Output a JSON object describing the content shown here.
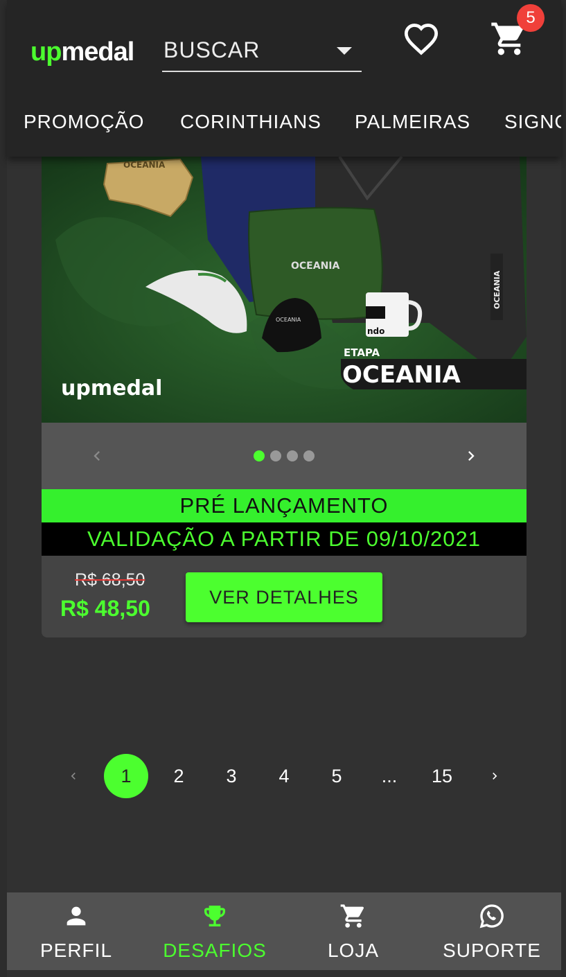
{
  "header": {
    "logo_up": "up",
    "logo_rest": "medal",
    "search_label": "BUSCAR",
    "cart_count": "5",
    "nav": [
      "PROMOÇÃO",
      "CORINTHIANS",
      "PALMEIRAS",
      "SIGNO"
    ]
  },
  "product": {
    "banner": {
      "badge_text": "OCEANIA",
      "etapa": "ETAPA",
      "title": "OCEANIA",
      "brand": "upmedal",
      "cap_text": "OCEANIA",
      "pillow_text": "OCEANIA",
      "mug_text": "ndo",
      "jacket_text": "OCEANIA"
    },
    "carousel": {
      "slides": 4,
      "active": 1
    },
    "ribbon_title": "PRÉ LANÇAMENTO",
    "ribbon_subtitle": "VALIDAÇÃO A PARTIR DE 09/10/2021",
    "old_price": "R$ 68,50",
    "new_price": "R$ 48,50",
    "details_button": "VER DETALHES"
  },
  "pagination": {
    "pages": [
      "1",
      "2",
      "3",
      "4",
      "5",
      "...",
      "15"
    ],
    "active": "1"
  },
  "bottom_nav": [
    {
      "label": "PERFIL",
      "icon": "person-icon",
      "active": false
    },
    {
      "label": "DESAFIOS",
      "icon": "trophy-icon",
      "active": true
    },
    {
      "label": "LOJA",
      "icon": "cart-icon",
      "active": false
    },
    {
      "label": "SUPORTE",
      "icon": "whatsapp-icon",
      "active": false
    }
  ],
  "colors": {
    "accent": "#4cff2f",
    "badge": "#f0403a",
    "header_bg": "#252525",
    "page_bg": "#313131"
  }
}
